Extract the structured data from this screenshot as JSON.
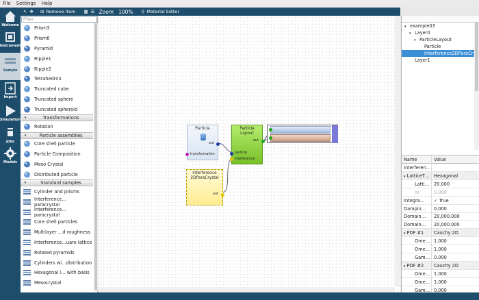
{
  "menu": [
    "File",
    "Settings",
    "Help"
  ],
  "leftbar": [
    {
      "label": "Welcome",
      "icon": "home-icon"
    },
    {
      "label": "Instrument",
      "icon": "instrument-icon"
    },
    {
      "label": "Sample",
      "icon": "sample-icon"
    },
    {
      "label": "Import",
      "icon": "import-icon"
    },
    {
      "label": "Simulation",
      "icon": "simulation-icon"
    },
    {
      "label": "Jobs",
      "icon": "jobs-icon"
    },
    {
      "label": "Models",
      "icon": "gear-icon"
    }
  ],
  "toolbar": {
    "remove_label": "Remove item",
    "zoom_label": "Zoom",
    "zoom_value": "100%",
    "material_editor_label": "Material Editor"
  },
  "palette": {
    "filter_placeholder": "Filter",
    "rows": [
      {
        "type": "item",
        "label": "Prism3",
        "icon": "prism3-icon"
      },
      {
        "type": "item",
        "label": "Prism6",
        "icon": "prism6-icon"
      },
      {
        "type": "item",
        "label": "Pyramid",
        "icon": "pyramid-icon"
      },
      {
        "type": "item",
        "label": "Ripple1",
        "icon": "ripple1-icon"
      },
      {
        "type": "item",
        "label": "Ripple2",
        "icon": "ripple2-icon"
      },
      {
        "type": "item",
        "label": "Tetrahedron",
        "icon": "tetrahedron-icon"
      },
      {
        "type": "item",
        "label": "Truncated cube",
        "icon": "truncated-cube-icon"
      },
      {
        "type": "item",
        "label": "Truncated sphere",
        "icon": "truncated-sphere-icon"
      },
      {
        "type": "item",
        "label": "Truncated spheroid",
        "icon": "truncated-spheroid-icon"
      },
      {
        "type": "header",
        "label": "Transformations"
      },
      {
        "type": "item",
        "label": "Rotation",
        "icon": "rotation-icon"
      },
      {
        "type": "header",
        "label": "Particle assemblies"
      },
      {
        "type": "item",
        "label": "Core shell particle",
        "icon": "core-shell-icon"
      },
      {
        "type": "item",
        "label": "Particle Composition",
        "icon": "particle-composition-icon"
      },
      {
        "type": "item",
        "label": "Meso Crystal",
        "icon": "meso-crystal-icon"
      },
      {
        "type": "item",
        "label": "Distributed particle",
        "icon": "distributed-particle-icon"
      },
      {
        "type": "header",
        "label": "Standard samples"
      },
      {
        "type": "item",
        "label": "Cylinder and prisms",
        "icon": "sample-layers-icon"
      },
      {
        "type": "item",
        "label": "Interference… paracrystal",
        "icon": "sample-layers-icon"
      },
      {
        "type": "item",
        "label": "Interference… paracrystal",
        "icon": "sample-layers-icon"
      },
      {
        "type": "item",
        "label": "Core shell particles",
        "icon": "sample-layers-icon"
      },
      {
        "type": "item",
        "label": "Multilayer …d roughness",
        "icon": "sample-layers-icon"
      },
      {
        "type": "item",
        "label": "Interference…uare lattice",
        "icon": "sample-layers-icon"
      },
      {
        "type": "item",
        "label": "Rotated pyramids",
        "icon": "sample-layers-icon"
      },
      {
        "type": "item",
        "label": "Cylinders wi…distribution",
        "icon": "sample-layers-icon"
      },
      {
        "type": "item",
        "label": "Hexagonal l… with basis",
        "icon": "sample-layers-icon"
      },
      {
        "type": "item",
        "label": "Mesocrystal",
        "icon": "sample-layers-icon"
      }
    ]
  },
  "nodes": {
    "particle": {
      "title": "Particle",
      "out": "out",
      "transformation": "transformation"
    },
    "layout": {
      "title": "Particle\nLayout",
      "out": "out",
      "particle": "particle",
      "interference": "interference"
    },
    "interference": {
      "title": "Interference\n2DParaCrystal",
      "out": "out"
    }
  },
  "tree": {
    "header": "",
    "rows": [
      {
        "label": "example03",
        "level": 0,
        "arrow": "▾"
      },
      {
        "label": "Layer0",
        "level": 1,
        "arrow": "▾"
      },
      {
        "label": "ParticleLayout",
        "level": 2,
        "arrow": "▾"
      },
      {
        "label": "Particle",
        "level": 3,
        "arrow": ""
      },
      {
        "label": "Interference2DParaCrystal",
        "level": 3,
        "arrow": "",
        "selected": true
      },
      {
        "label": "Layer1",
        "level": 1,
        "arrow": ""
      }
    ]
  },
  "properties": {
    "col_name": "Name",
    "col_value": "Value",
    "rows": [
      {
        "k": "Interferen…",
        "v": "",
        "indent": 0,
        "style": ""
      },
      {
        "k": "LatticeT…",
        "v": "Hexagonal",
        "indent": 0,
        "arrow": "▾",
        "style": "grp"
      },
      {
        "k": "Latti…",
        "v": "20.000",
        "indent": 2,
        "style": ""
      },
      {
        "k": "Xi",
        "v": "0.000",
        "indent": 2,
        "style": "dis"
      },
      {
        "k": "Integra…",
        "v": "✓ True",
        "indent": 0,
        "style": ""
      },
      {
        "k": "Dampin…",
        "v": "0.000",
        "indent": 0,
        "style": ""
      },
      {
        "k": "Domain…",
        "v": "20,000.000",
        "indent": 0,
        "style": ""
      },
      {
        "k": "Domain…",
        "v": "20,000.000",
        "indent": 0,
        "style": ""
      },
      {
        "k": "PDF #1",
        "v": "Cauchy 2D",
        "indent": 0,
        "arrow": "▾",
        "style": "grp"
      },
      {
        "k": "Ome…",
        "v": "1.000",
        "indent": 2,
        "style": ""
      },
      {
        "k": "Ome…",
        "v": "1.000",
        "indent": 2,
        "style": ""
      },
      {
        "k": "Gam…",
        "v": "0.000",
        "indent": 2,
        "style": ""
      },
      {
        "k": "PDF #2",
        "v": "Cauchy 2D",
        "indent": 0,
        "arrow": "▾",
        "style": "grp"
      },
      {
        "k": "Ome…",
        "v": "1.000",
        "indent": 2,
        "style": ""
      },
      {
        "k": "Ome…",
        "v": "1.000",
        "indent": 2,
        "style": ""
      },
      {
        "k": "Gam…",
        "v": "0.000",
        "indent": 2,
        "style": ""
      }
    ]
  },
  "colors": {
    "sidebar": "#1e4d6b",
    "selection": "#3a8fd8",
    "layout_node": "#8cd23e",
    "interference_node": "#fff3a6",
    "particle_node": "#e6eef8"
  }
}
